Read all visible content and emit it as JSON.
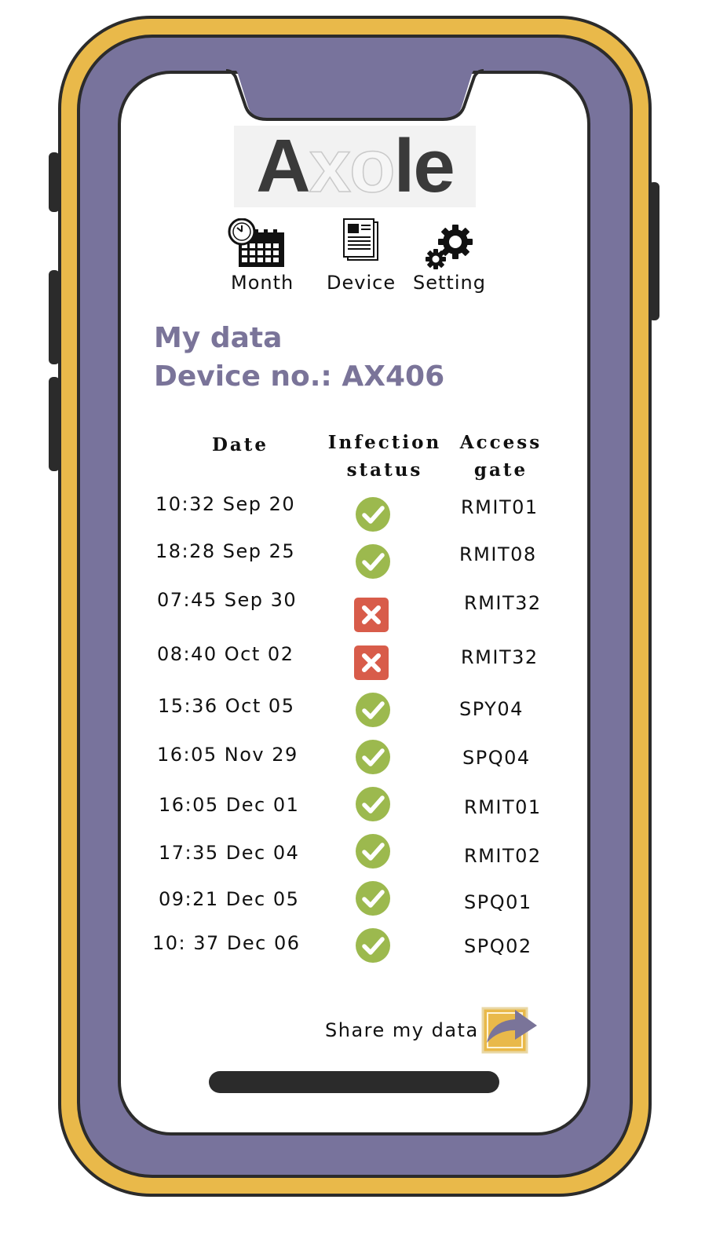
{
  "app": {
    "logo_text": {
      "dark1": "A",
      "light1": "xo",
      "dark2": "le",
      "full": "Axole"
    }
  },
  "nav": [
    {
      "label": "Month",
      "icon": "calendar-clock-icon"
    },
    {
      "label": "Device",
      "icon": "document-icon"
    },
    {
      "label": "Setting",
      "icon": "gears-icon"
    }
  ],
  "header": {
    "title": "My data",
    "device": "Device no.: AX406"
  },
  "table": {
    "headers": {
      "date": "Date",
      "status_line1": "Infection",
      "status_line2": "status",
      "gate_line1": "Access",
      "gate_line2": "gate"
    },
    "rows": [
      {
        "date": "10:32 Sep 20",
        "status": "ok",
        "gate": "RMIT01"
      },
      {
        "date": "18:28 Sep 25",
        "status": "ok",
        "gate": "RMIT08"
      },
      {
        "date": "07:45 Sep 30",
        "status": "infected",
        "gate": "RMIT32"
      },
      {
        "date": "08:40 Oct 02",
        "status": "infected",
        "gate": "RMIT32"
      },
      {
        "date": "15:36 Oct 05",
        "status": "ok",
        "gate": "SPY04"
      },
      {
        "date": "16:05 Nov 29",
        "status": "ok",
        "gate": "SPQ04"
      },
      {
        "date": "16:05 Dec 01",
        "status": "ok",
        "gate": "RMIT01"
      },
      {
        "date": "17:35 Dec 04",
        "status": "ok",
        "gate": "RMIT02"
      },
      {
        "date": "09:21 Dec 05",
        "status": "ok",
        "gate": "SPQ01"
      },
      {
        "date": "10: 37 Dec 06",
        "status": "ok",
        "gate": "SPQ02"
      }
    ]
  },
  "share": {
    "label": "Share my data",
    "icon": "share-arrow-icon"
  },
  "colors": {
    "frame_yellow": "#e9b94a",
    "frame_purple": "#78739c",
    "heading_purple": "#7a7499",
    "ok_green": "#9cb94e",
    "error_red": "#d85c4a"
  }
}
